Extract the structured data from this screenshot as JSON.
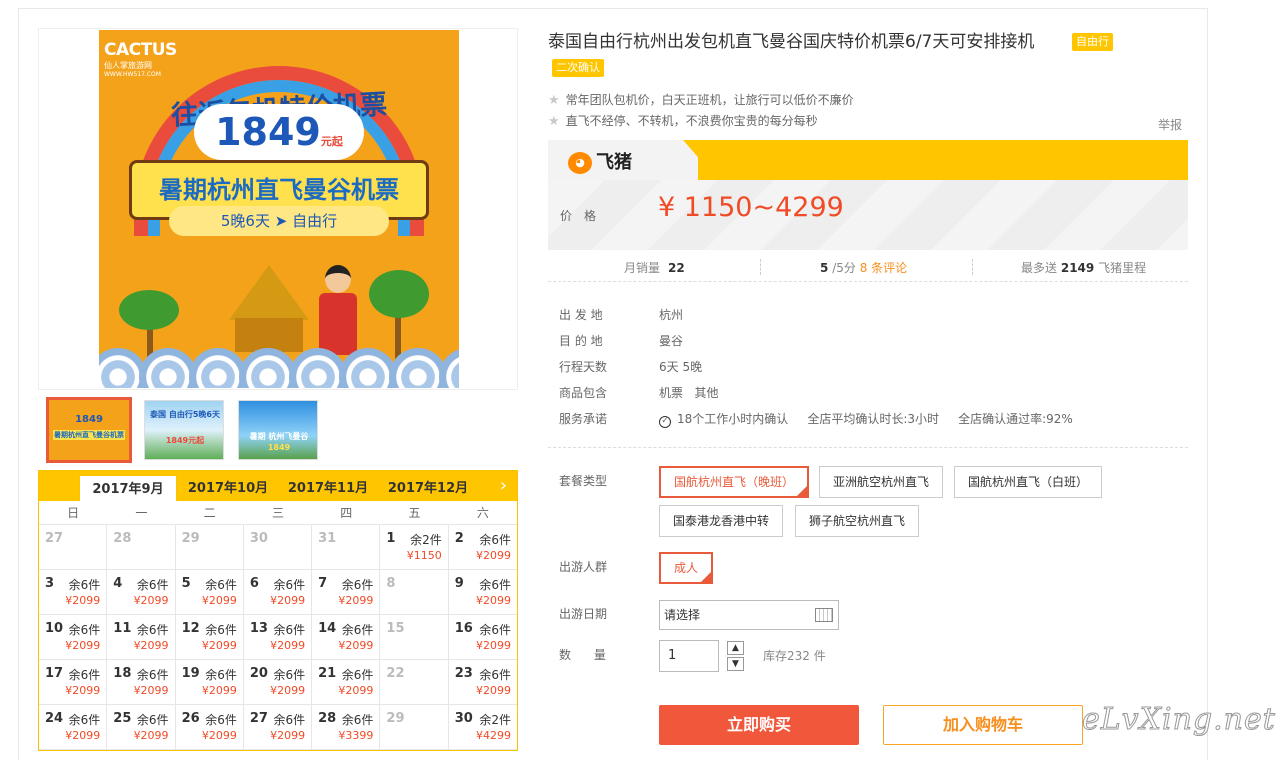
{
  "product": {
    "title": "泰国自由行杭州出发包机直飞曼谷国庆特价机票6/7天可安排接机",
    "tag_free": "自由行",
    "tag_confirm": "二次确认",
    "features": [
      "常年团队包机价，白天正班机，让旅行可以低价不廉价",
      "直飞不经停、不转机，不浪费你宝贵的每分每秒"
    ],
    "report": "举报",
    "brand": "飞猪",
    "price_label": "价格",
    "price": "¥ 1150~4299"
  },
  "poster": {
    "logo": "CACTUS",
    "logo_sub": "仙人掌旅游网",
    "logo_url": "WWW.HW517.COM",
    "title_top": "往返包机特价机票",
    "price": "1849",
    "price_unit": "元起",
    "banner": "暑期杭州直飞曼谷机票",
    "sub": "5晚6天 ➤ 自由行"
  },
  "thumbs": [
    {
      "caption": "1849",
      "caption2": "暑期杭州直飞曼谷机票"
    },
    {
      "caption": "泰国 自由行5晚6天",
      "caption2": "1849元起"
    },
    {
      "caption": "暑期 杭州飞曼谷",
      "caption2": "1849"
    }
  ],
  "stats": {
    "monthly_label": "月销量",
    "monthly_value": "22",
    "score": "5",
    "score_suffix": "/5分",
    "reviews": "8 条评论",
    "points_prefix": "最多送",
    "points_value": "2149",
    "points_suffix": "飞猪里程"
  },
  "info": [
    {
      "label": "出 发 地",
      "value": "杭州"
    },
    {
      "label": "目 的 地",
      "value": "曼谷"
    },
    {
      "label": "行程天数",
      "value": "6天 5晚"
    },
    {
      "label": "商品包含",
      "value": "机票   其他"
    },
    {
      "label": "服务承诺",
      "value": "18个工作小时内确认     全店平均确认时长:3小时     全店确认通过率:92%"
    }
  ],
  "options": {
    "package_label": "套餐类型",
    "packages": [
      "国航杭州直飞（晚班）",
      "亚洲航空杭州直飞",
      "国航杭州直飞（白班）",
      "国泰港龙香港中转",
      "狮子航空杭州直飞"
    ],
    "people_label": "出游人群",
    "people": [
      "成人"
    ],
    "date_label": "出游日期",
    "date_placeholder": "请选择",
    "qty_label": "数      量",
    "qty_value": "1",
    "stock": "库存232 件"
  },
  "buttons": {
    "buy": "立即购买",
    "cart": "加入购物车"
  },
  "watermark": "eLvXing.net",
  "calendar": {
    "tabs": [
      "2017年9月",
      "2017年10月",
      "2017年11月",
      "2017年12月"
    ],
    "next": "›",
    "weekdays": [
      "日",
      "一",
      "二",
      "三",
      "四",
      "五",
      "六"
    ],
    "days": [
      {
        "d": "27",
        "dim": true
      },
      {
        "d": "28",
        "dim": true
      },
      {
        "d": "29",
        "dim": true
      },
      {
        "d": "30",
        "dim": true
      },
      {
        "d": "31",
        "dim": true
      },
      {
        "d": "1",
        "s": "余2件",
        "p": "¥1150"
      },
      {
        "d": "2",
        "s": "余6件",
        "p": "¥2099"
      },
      {
        "d": "3",
        "s": "余6件",
        "p": "¥2099"
      },
      {
        "d": "4",
        "s": "余6件",
        "p": "¥2099"
      },
      {
        "d": "5",
        "s": "余6件",
        "p": "¥2099"
      },
      {
        "d": "6",
        "s": "余6件",
        "p": "¥2099"
      },
      {
        "d": "7",
        "s": "余6件",
        "p": "¥2099"
      },
      {
        "d": "8",
        "dim": true
      },
      {
        "d": "9",
        "s": "余6件",
        "p": "¥2099"
      },
      {
        "d": "10",
        "s": "余6件",
        "p": "¥2099"
      },
      {
        "d": "11",
        "s": "余6件",
        "p": "¥2099"
      },
      {
        "d": "12",
        "s": "余6件",
        "p": "¥2099"
      },
      {
        "d": "13",
        "s": "余6件",
        "p": "¥2099"
      },
      {
        "d": "14",
        "s": "余6件",
        "p": "¥2099"
      },
      {
        "d": "15",
        "dim": true
      },
      {
        "d": "16",
        "s": "余6件",
        "p": "¥2099"
      },
      {
        "d": "17",
        "s": "余6件",
        "p": "¥2099"
      },
      {
        "d": "18",
        "s": "余6件",
        "p": "¥2099"
      },
      {
        "d": "19",
        "s": "余6件",
        "p": "¥2099"
      },
      {
        "d": "20",
        "s": "余6件",
        "p": "¥2099"
      },
      {
        "d": "21",
        "s": "余6件",
        "p": "¥2099"
      },
      {
        "d": "22",
        "dim": true
      },
      {
        "d": "23",
        "s": "余6件",
        "p": "¥2099"
      },
      {
        "d": "24",
        "s": "余6件",
        "p": "¥2099"
      },
      {
        "d": "25",
        "s": "余6件",
        "p": "¥2099"
      },
      {
        "d": "26",
        "s": "余6件",
        "p": "¥2099"
      },
      {
        "d": "27",
        "s": "余6件",
        "p": "¥2099"
      },
      {
        "d": "28",
        "s": "余6件",
        "p": "¥3399"
      },
      {
        "d": "29",
        "dim": true
      },
      {
        "d": "30",
        "s": "余2件",
        "p": "¥4299"
      }
    ]
  },
  "colors": {
    "accent": "#f04b27",
    "yellow": "#ffc600",
    "orange": "#f78f1e"
  }
}
